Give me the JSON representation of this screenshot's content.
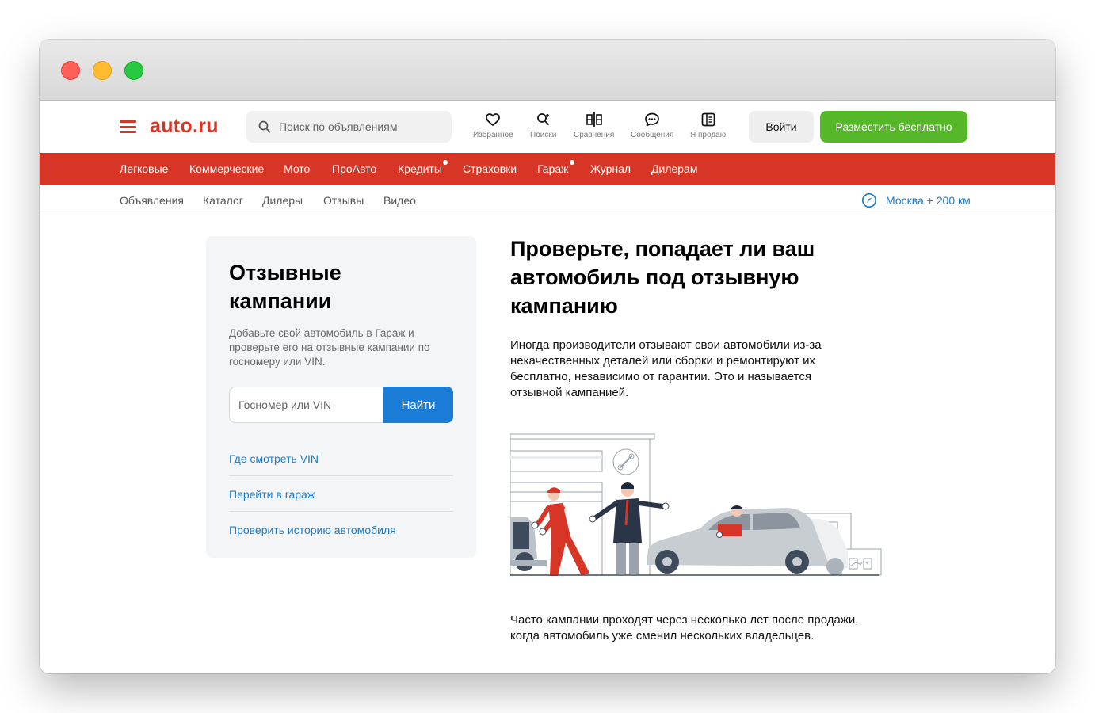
{
  "header": {
    "logo": "auto.ru",
    "search_placeholder": "Поиск по объявлениям",
    "icons": [
      {
        "icon": "heart-icon",
        "label": "Избранное"
      },
      {
        "icon": "saved-search-icon",
        "label": "Поиски"
      },
      {
        "icon": "compare-icon",
        "label": "Сравнения"
      },
      {
        "icon": "chat-icon",
        "label": "Сообщения"
      },
      {
        "icon": "selling-icon",
        "label": "Я продаю"
      }
    ],
    "login_label": "Войти",
    "post_label": "Разместить бесплатно"
  },
  "red_nav": [
    "Легковые",
    "Коммерческие",
    "Мото",
    "ПроАвто",
    "Кредиты",
    "Страховки",
    "Гараж",
    "Журнал",
    "Дилерам"
  ],
  "sub_nav": [
    "Объявления",
    "Каталог",
    "Дилеры",
    "Отзывы",
    "Видео"
  ],
  "geo": {
    "icon": "location-compass-icon",
    "label": "Москва + 200 км"
  },
  "card": {
    "title": "Отзывные кампании",
    "description": "Добавьте свой автомобиль в Гараж и проверьте его на отзывные кампании по госномеру или VIN.",
    "input_placeholder": "Госномер или VIN",
    "find_label": "Найти",
    "links": [
      "Где смотреть VIN",
      "Перейти в гараж",
      "Проверить историю автомобиля"
    ]
  },
  "main": {
    "title": "Проверьте, попадает ли ваш автомобиль под отзывную кампанию",
    "text": "Иногда производители отзывают свои автомобили из-за некачественных деталей или сборки и ремонтируют их бесплатно, независимо от гарантии. Это и называется отзывной кампанией.",
    "bottom_text": "Часто кампании проходят через несколько лет после продажи, когда автомобиль уже сменил нескольких владельцев."
  },
  "colors": {
    "brand_red": "#d73627",
    "accent_green": "#56b728",
    "link_blue": "#1b7cc6",
    "button_blue": "#1b7cd7"
  }
}
